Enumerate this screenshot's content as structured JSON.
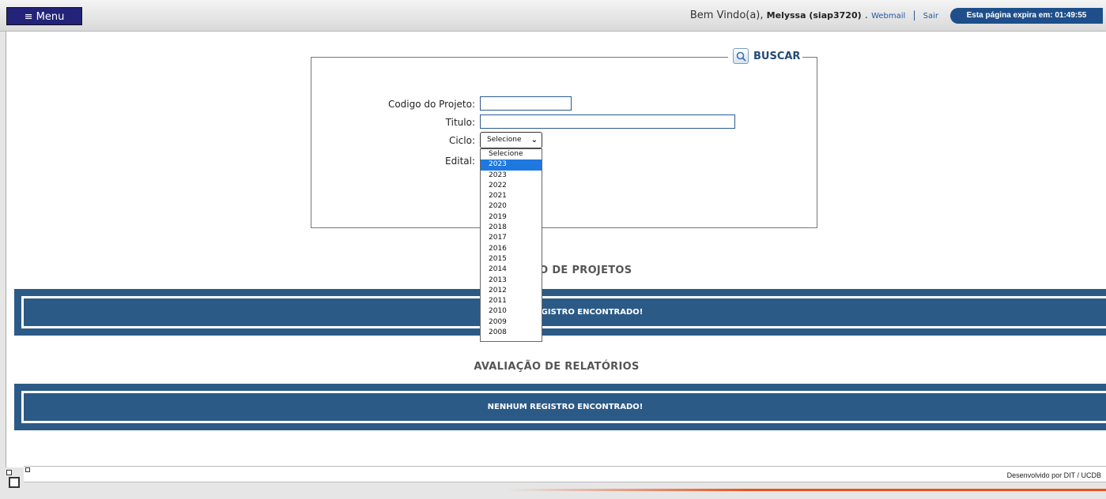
{
  "header": {
    "menu_label": "≡ Menu",
    "welcome": "Bem Vindo(a),",
    "user": "Melyssa (siap3720)",
    "dot": ".",
    "webmail": "Webmail",
    "separator": "|",
    "logout": "Sair",
    "expiry": "Esta página expira em: 01:49:55"
  },
  "search": {
    "legend": "BUSCAR",
    "fields": {
      "codigo_label": "Codigo do Projeto:",
      "codigo_value": "",
      "titulo_label": "Titulo:",
      "titulo_value": "",
      "ciclo_label": "Ciclo:",
      "ciclo_selected": "Selecione",
      "edital_label": "Edital:"
    },
    "ciclo_options": [
      "Selecione",
      "2023",
      "2023",
      "2022",
      "2021",
      "2020",
      "2019",
      "2018",
      "2017",
      "2016",
      "2015",
      "2014",
      "2013",
      "2012",
      "2011",
      "2010",
      "2009",
      "2008"
    ],
    "ciclo_highlighted_index": 1
  },
  "sections": [
    {
      "title": "AVALIAÇÃO DE PROJETOS",
      "message": "NENHUM REGISTRO ENCONTRADO!"
    },
    {
      "title": "AVALIAÇÃO DE RELATÓRIOS",
      "message": "NENHUM REGISTRO ENCONTRADO!"
    }
  ],
  "footer": {
    "credit": "Desenvolvido por DIT / UCDB"
  },
  "colors": {
    "nav": "#23237a",
    "band": "#2c5a86",
    "highlight": "#1e78e0"
  }
}
